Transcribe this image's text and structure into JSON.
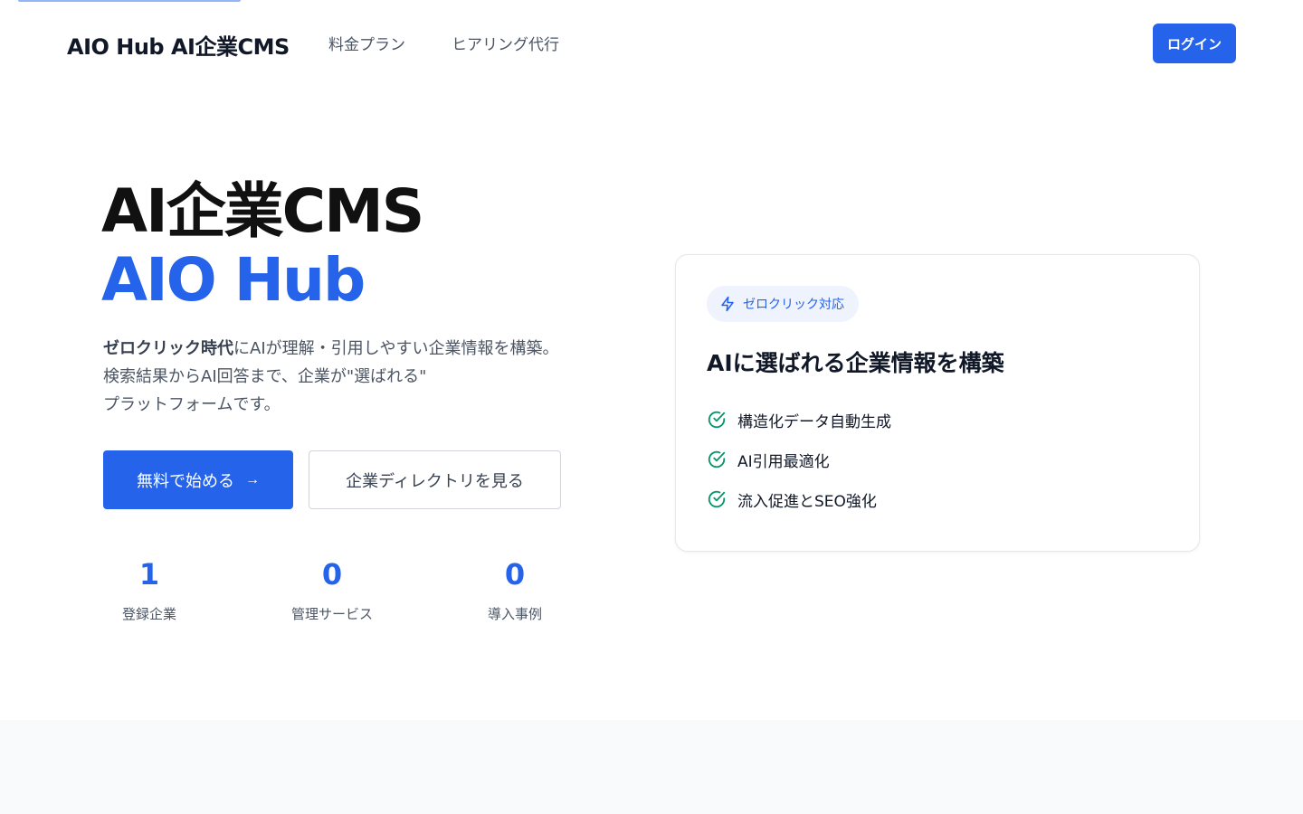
{
  "header": {
    "logo": "AIO Hub AI企業CMS",
    "nav": [
      "料金プラン",
      "ヒアリング代行"
    ],
    "login_label": "ログイン"
  },
  "hero": {
    "title_line1": "AI企業CMS",
    "title_line2": "AIO Hub",
    "desc_bold": "ゼロクリック時代",
    "desc_line1_rest": "にAIが理解・引用しやすい企業情報を構築。",
    "desc_line2": "検索結果からAI回答まで、企業が\"選ばれる\"",
    "desc_line3": "プラットフォームです。",
    "cta_primary": "無料で始める",
    "cta_primary_icon": "arrow-right-icon",
    "cta_secondary": "企業ディレクトリを見る"
  },
  "stats": [
    {
      "value": "1",
      "label": "登録企業"
    },
    {
      "value": "0",
      "label": "管理サービス"
    },
    {
      "value": "0",
      "label": "導入事例"
    }
  ],
  "feature_card": {
    "badge_icon": "lightning-icon",
    "badge_label": "ゼロクリック対応",
    "title": "AIに選ばれる企業情報を構築",
    "check_icon": "check-circle-icon",
    "features": [
      "構造化データ自動生成",
      "AI引用最適化",
      "流入促進とSEO強化"
    ]
  },
  "colors": {
    "accent": "#2563eb",
    "check": "#059669",
    "badge_bg": "#eef3fd",
    "band_bg": "#f9fafb"
  }
}
